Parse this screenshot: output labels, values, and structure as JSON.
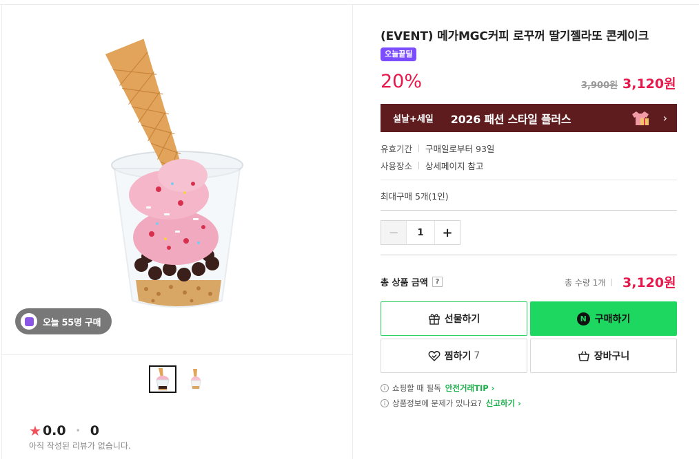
{
  "gallery": {
    "buy_count_text": "오늘 55명 구매",
    "thumbnails": [
      "thumbnail-1",
      "thumbnail-2"
    ],
    "rating_score": "0.0",
    "review_count": "0",
    "no_review_text": "아직 작성된 리뷰가 없습니다."
  },
  "product": {
    "title": "(EVENT) 메가MGC커피 로꾸꺼 딸기젤라또 콘케이크",
    "deal_badge": "오늘끝딜",
    "discount_rate": "20%",
    "original_price": "3,900원",
    "sale_price": "3,120원"
  },
  "promo_banner": {
    "tag": "설날+세일",
    "title": "2026 패션 스타일 플러스",
    "arrow": "›"
  },
  "details": {
    "validity_label": "유효기간",
    "validity_value": "구매일로부터 93일",
    "location_label": "사용장소",
    "location_value": "상세페이지 참고",
    "max_purchase": "최대구매 5개(1인)"
  },
  "quantity": {
    "minus": "−",
    "value": "1",
    "plus": "+"
  },
  "total": {
    "label": "총 상품 금액",
    "help": "?",
    "qty_text": "총 수량 1개",
    "price": "3,120원"
  },
  "buttons": {
    "gift": "선물하기",
    "buy": "구매하기",
    "npay_mark": "N",
    "wish": "찜하기",
    "wish_count": "7",
    "cart": "장바구니"
  },
  "tips": [
    {
      "text": "쇼핑할 때 필독",
      "link": "안전거래TIP ›"
    },
    {
      "text": "상품정보에 문제가 있나요?",
      "link": "신고하기 ›"
    }
  ],
  "colors": {
    "price_red": "#e5194b",
    "npay_green": "#1ed760",
    "deal_purple": "#7c4dff",
    "banner_maroon": "#5e1c1e"
  }
}
